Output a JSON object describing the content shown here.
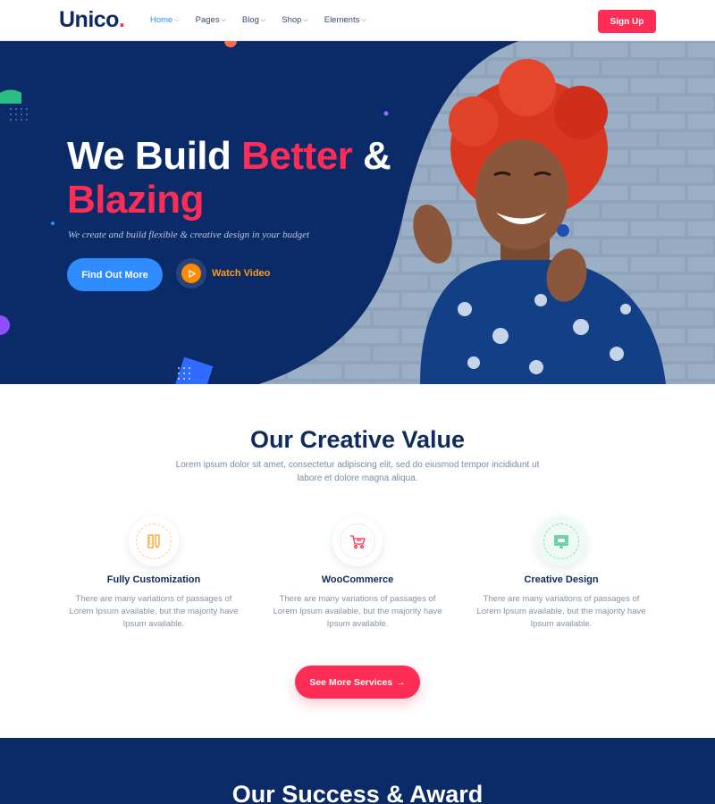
{
  "nav": {
    "logo": "Unico",
    "logo_dot": ".",
    "items": [
      {
        "label": "Home",
        "active": true
      },
      {
        "label": "Pages",
        "active": false
      },
      {
        "label": "Blog",
        "active": false
      },
      {
        "label": "Shop",
        "active": false
      },
      {
        "label": "Elements",
        "active": false
      }
    ],
    "chevron": "⌵",
    "signup_label": "Sign Up"
  },
  "hero": {
    "title_line1_a": "We Build ",
    "title_line1_b": "Better",
    "title_line1_c": " &",
    "title_line2": "Blazing",
    "subtitle": "We create and build flexible & creative design in your budget",
    "primary_button": "Find Out More",
    "video_label": "Watch Video",
    "video_icon": "play-icon"
  },
  "creative_value": {
    "title": "Our Creative Value",
    "description": "Lorem ipsum dolor sit amet, consectetur adipiscing elit, sed do eiusmod tempor incididunt ut labore et dolore magna aliqua.",
    "features": [
      {
        "title": "Fully Customization",
        "text": "There are many variations of passages of Lorem Ipsum available, but the majority have Ipsum available.",
        "icon": "pencil-ruler-icon",
        "color": "#ff9d1e"
      },
      {
        "title": "WooCommerce",
        "text": "There are many variations of passages of Lorem Ipsum available, but the majority have Ipsum available.",
        "icon": "shopping-cart-icon",
        "color": "#ff2d55"
      },
      {
        "title": "Creative Design",
        "text": "There are many variations of passages of Lorem Ipsum available, but the majority have Ipsum available.",
        "icon": "monitor-icon",
        "color": "#2bbd86"
      }
    ],
    "button": "See More Services",
    "button_arrow": "→"
  },
  "success": {
    "title": "Our Success & Award"
  },
  "colors": {
    "navy": "#0b2a68",
    "primary_pink": "#ff2d55",
    "primary_blue": "#2f8cff",
    "orange": "#ff9d1e",
    "green": "#2bbd86"
  }
}
